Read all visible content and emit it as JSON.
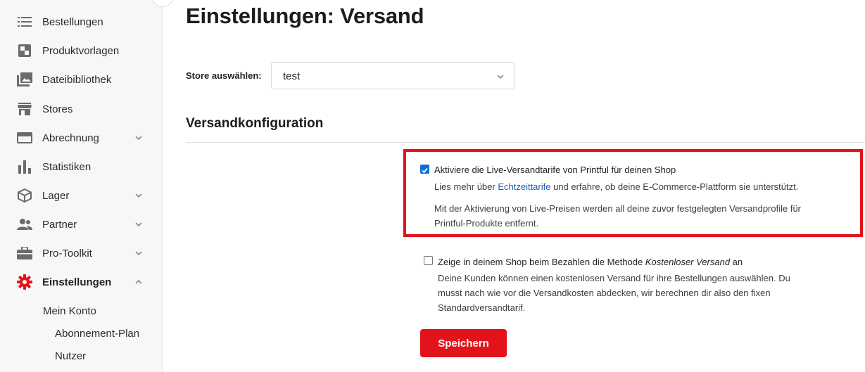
{
  "sidebar": {
    "items": [
      {
        "label": "Bestellungen",
        "icon": "list-icon"
      },
      {
        "label": "Produktvorlagen",
        "icon": "template-icon"
      },
      {
        "label": "Dateibibliothek",
        "icon": "image-library-icon"
      },
      {
        "label": "Stores",
        "icon": "store-icon"
      },
      {
        "label": "Abrechnung",
        "icon": "credit-card-icon"
      },
      {
        "label": "Statistiken",
        "icon": "bar-chart-icon"
      },
      {
        "label": "Lager",
        "icon": "box-icon"
      },
      {
        "label": "Partner",
        "icon": "people-icon"
      },
      {
        "label": "Pro-Toolkit",
        "icon": "briefcase-icon"
      },
      {
        "label": "Einstellungen",
        "icon": "gear-icon"
      }
    ],
    "sub_items": [
      "Mein Konto",
      "Abonnement-Plan",
      "Nutzer"
    ],
    "active_color": "#e3131b"
  },
  "page": {
    "title": "Einstellungen: Versand",
    "store_label": "Store auswählen:",
    "store_value": "test",
    "section_title": "Versandkonfiguration"
  },
  "options": {
    "live_rates": {
      "checked": true,
      "label": "Aktiviere die Live-Versandtarife von Printful für deinen Shop",
      "desc_before": "Lies mehr über ",
      "link": "Echtzeittarife",
      "desc_after": " und erfahre, ob deine E-Commerce-Plattform sie unterstützt.",
      "note_line1": "Mit der Aktivierung von Live-Preisen werden all deine zuvor festgelegten Versandprofile für",
      "note_line2": "Printful-Produkte entfernt."
    },
    "free_shipping": {
      "checked": false,
      "label_before": "Zeige in deinem Shop beim Bezahlen die Methode ",
      "label_em": "Kostenloser Versand",
      "label_after": " an",
      "desc_line1": "Deine Kunden können einen kostenlosen Versand für ihre Bestellungen auswählen. Du",
      "desc_line2": "musst nach wie vor die Versandkosten abdecken, wir berechnen dir also den fixen",
      "desc_line3": "Standardversandtarif."
    }
  },
  "save_label": "Speichern",
  "colors": {
    "brand_red": "#e3131b",
    "checkbox_blue": "#0a6fdc",
    "link_blue": "#1f5fb0"
  }
}
